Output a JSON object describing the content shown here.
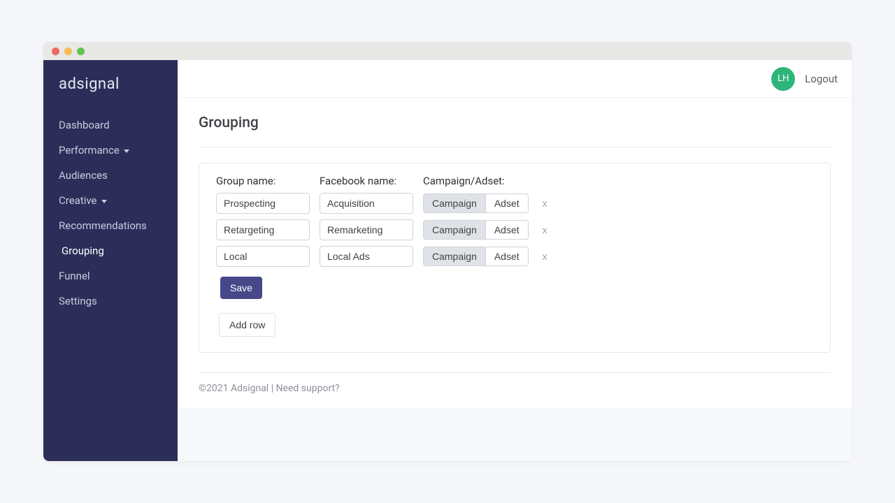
{
  "brand": "adsignal",
  "avatar_initials": "LH",
  "logout_label": "Logout",
  "sidebar": {
    "items": [
      {
        "label": "Dashboard",
        "has_caret": false,
        "active": false
      },
      {
        "label": "Performance",
        "has_caret": true,
        "active": false
      },
      {
        "label": "Audiences",
        "has_caret": false,
        "active": false
      },
      {
        "label": "Creative",
        "has_caret": true,
        "active": false
      },
      {
        "label": "Recommendations",
        "has_caret": false,
        "active": false
      },
      {
        "label": "Grouping",
        "has_caret": false,
        "active": true
      },
      {
        "label": "Funnel",
        "has_caret": false,
        "active": false
      },
      {
        "label": "Settings",
        "has_caret": false,
        "active": false
      }
    ]
  },
  "page": {
    "title": "Grouping",
    "headers": {
      "group_name": "Group name:",
      "facebook_name": "Facebook name:",
      "campaign_adset": "Campaign/Adset:"
    },
    "type_options": {
      "campaign": "Campaign",
      "adset": "Adset"
    },
    "rows": [
      {
        "group": "Prospecting",
        "fb": "Acquisition",
        "type": "campaign"
      },
      {
        "group": "Retargeting",
        "fb": "Remarketing",
        "type": "campaign"
      },
      {
        "group": "Local",
        "fb": "Local Ads",
        "type": "campaign"
      }
    ],
    "delete_glyph": "x",
    "save_label": "Save",
    "add_row_label": "Add row"
  },
  "footer": {
    "copyright": "©2021 Adsignal",
    "separator": " | ",
    "support": "Need support?"
  }
}
